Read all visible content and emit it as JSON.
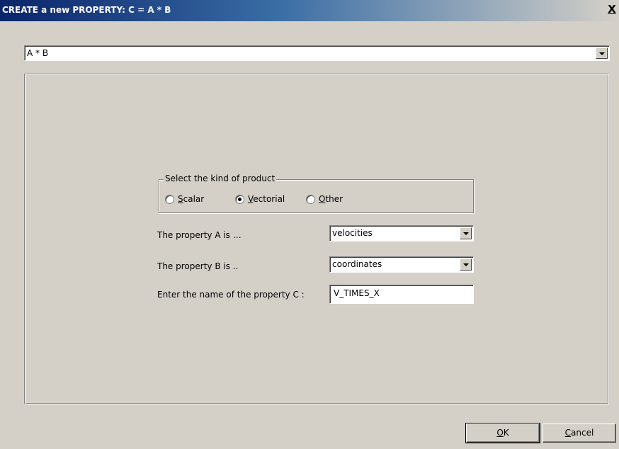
{
  "window": {
    "title": "CREATE a new PROPERTY: C = A * B",
    "close_glyph": "X"
  },
  "operation_select": {
    "value": "A * B"
  },
  "product_group": {
    "legend": "Select the kind of product",
    "options": [
      {
        "label_accel": "S",
        "label_rest": "calar",
        "checked": false
      },
      {
        "label_accel": "V",
        "label_rest": "ectorial",
        "checked": true
      },
      {
        "label_accel": "O",
        "label_rest": "ther",
        "checked": false
      }
    ]
  },
  "property_a": {
    "label": "The property A is …",
    "value": "velocities"
  },
  "property_b": {
    "label": "The property B is ..",
    "value": "coordinates"
  },
  "property_c": {
    "label": "Enter the name of the property C :",
    "value": "V_TIMES_X"
  },
  "buttons": {
    "ok_accel": "O",
    "ok_rest": "K",
    "cancel_accel": "C",
    "cancel_rest": "ancel"
  },
  "icons": {
    "close": "close-icon",
    "dropdown": "chevron-down-icon"
  },
  "colors": {
    "dialog_bg": "#d4d0c8",
    "titlebar_start": "#0a246a",
    "titlebar_end": "#d4d0c8"
  }
}
